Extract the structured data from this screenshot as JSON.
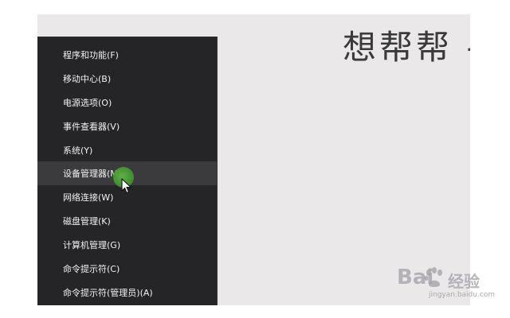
{
  "background_title": "想帮帮 -",
  "context_menu": {
    "items": [
      {
        "label": "程序和功能(F)"
      },
      {
        "label": "移动中心(B)"
      },
      {
        "label": "电源选项(O)"
      },
      {
        "label": "事件查看器(V)"
      },
      {
        "label": "系统(Y)"
      },
      {
        "label": "设备管理器(M)"
      },
      {
        "label": "网络连接(W)"
      },
      {
        "label": "磁盘管理(K)"
      },
      {
        "label": "计算机管理(G)"
      },
      {
        "label": "命令提示符(C)"
      },
      {
        "label": "命令提示符(管理员)(A)"
      }
    ],
    "highlighted_item": "设备管理器(M)"
  },
  "watermark": {
    "brand": "Bai",
    "suffix": "经验",
    "url": "jingyan.baidu.com"
  },
  "colors": {
    "menu_bg": "#252527",
    "menu_hover": "#3b3b3d",
    "menu_text": "#f2f2f2",
    "desktop_bg": "#ebe8ea",
    "cursor_highlight": "#4ea83a"
  },
  "icons": [
    "mouse-cursor-icon",
    "baidu-paw-icon"
  ]
}
